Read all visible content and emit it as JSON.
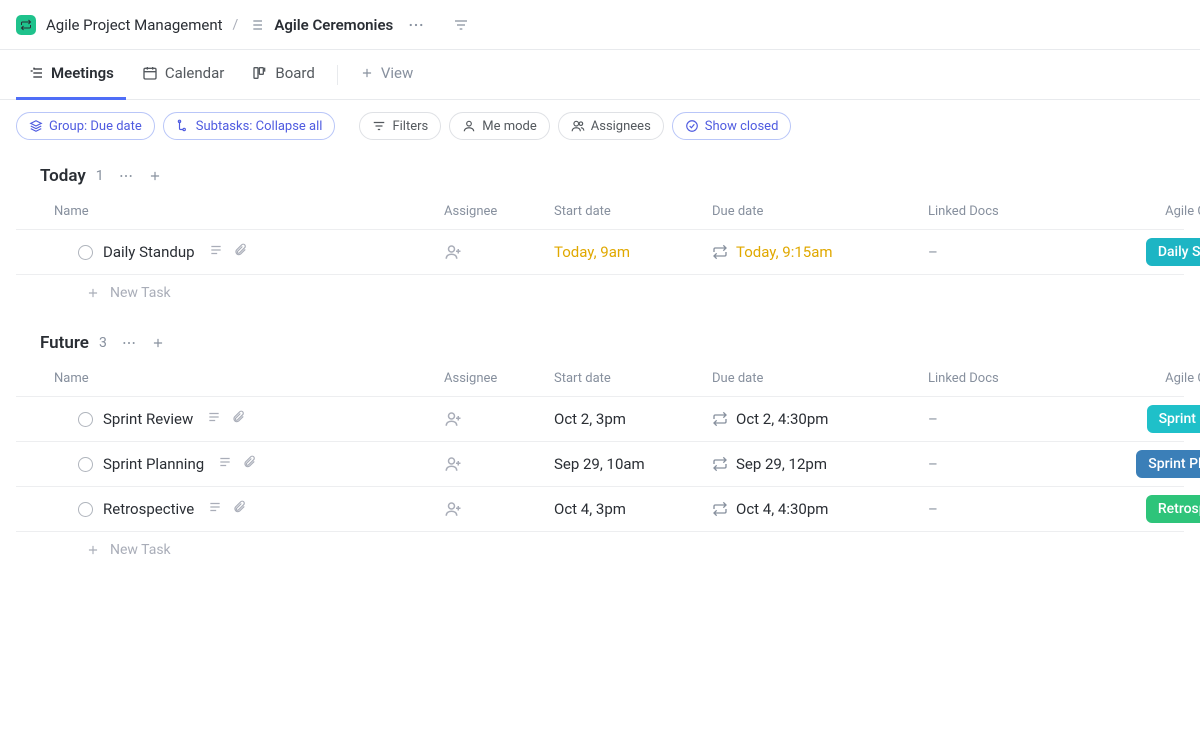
{
  "breadcrumb": {
    "space": "Agile Project Management",
    "separator": "/",
    "current": "Agile Ceremonies"
  },
  "views": {
    "tabs": [
      {
        "label": "Meetings",
        "active": true
      },
      {
        "label": "Calendar",
        "active": false
      },
      {
        "label": "Board",
        "active": false
      }
    ],
    "add_view_label": "View"
  },
  "chips": {
    "group": "Group: Due date",
    "subtasks": "Subtasks: Collapse all",
    "filters": "Filters",
    "me_mode": "Me mode",
    "assignees": "Assignees",
    "show_closed": "Show closed"
  },
  "columns": {
    "name": "Name",
    "assignee": "Assignee",
    "start": "Start date",
    "due": "Due date",
    "linked": "Linked Docs",
    "ceremony": "Agile Ceremony"
  },
  "groups": [
    {
      "title": "Today",
      "count": "1",
      "tasks": [
        {
          "name": "Daily Standup",
          "start": "Today, 9am",
          "due": "Today, 9:15am",
          "linked": "–",
          "ceremony": "Daily Standup",
          "color": "tag-teal",
          "warn": true
        }
      ]
    },
    {
      "title": "Future",
      "count": "3",
      "tasks": [
        {
          "name": "Sprint Review",
          "start": "Oct 2, 3pm",
          "due": "Oct 2, 4:30pm",
          "linked": "–",
          "ceremony": "Sprint Review",
          "color": "tag-teal-light",
          "warn": false
        },
        {
          "name": "Sprint Planning",
          "start": "Sep 29, 10am",
          "due": "Sep 29, 12pm",
          "linked": "–",
          "ceremony": "Sprint Planning",
          "color": "tag-blue",
          "warn": false
        },
        {
          "name": "Retrospective",
          "start": "Oct 4, 3pm",
          "due": "Oct 4, 4:30pm",
          "linked": "–",
          "ceremony": "Retrospective",
          "color": "tag-green",
          "warn": false
        }
      ]
    }
  ],
  "new_task_label": "New Task"
}
